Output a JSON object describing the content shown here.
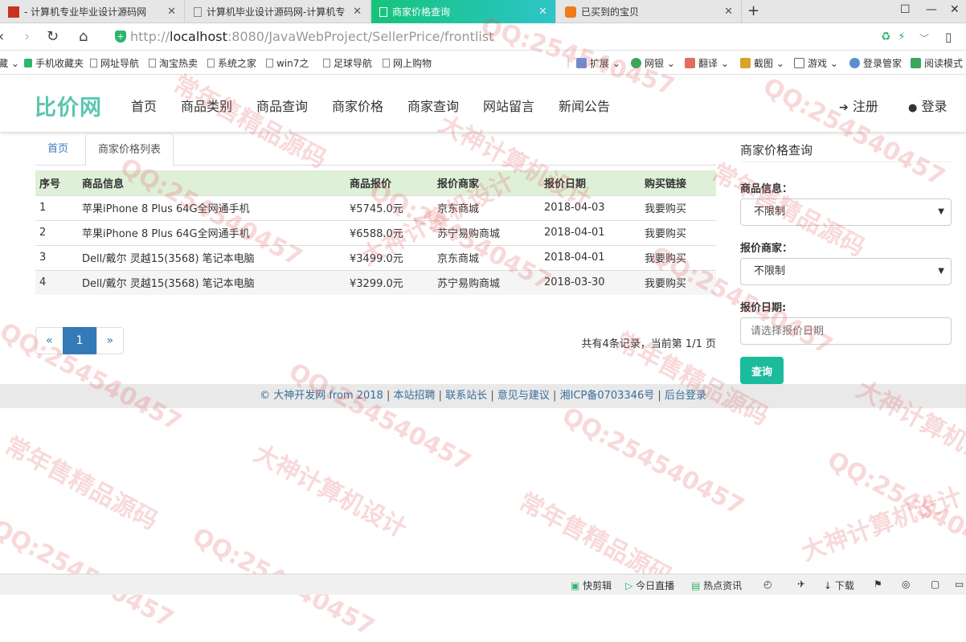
{
  "browser": {
    "tabs": [
      {
        "title": "- 计算机专业毕业设计源码网",
        "active": false
      },
      {
        "title": "计算机毕业设计源码网-计算机专",
        "active": false
      },
      {
        "title": "商家价格查询",
        "active": true
      },
      {
        "title": "已买到的宝贝",
        "active": false
      }
    ],
    "url_prefix": "http://",
    "url_host": "localhost",
    "url_path": ":8080/JavaWebProject/SellerPrice/frontlist",
    "bookmarks": [
      "藏",
      "手机收藏夹",
      "网址导航",
      "淘宝热卖",
      "系统之家",
      "win7之",
      "足球导航",
      "网上购物"
    ],
    "tools": [
      "扩展",
      "网银",
      "翻译",
      "截图",
      "游戏",
      "登录管家",
      "阅读模式"
    ]
  },
  "site": {
    "brand": "比价网",
    "menu": [
      "首页",
      "商品类别",
      "商品查询",
      "商家价格",
      "商家查询",
      "网站留言",
      "新闻公告"
    ],
    "register": "注册",
    "login": "登录"
  },
  "content": {
    "tabs": [
      "首页",
      "商家价格列表"
    ],
    "columns": [
      "序号",
      "商品信息",
      "商品报价",
      "报价商家",
      "报价日期",
      "购买链接"
    ],
    "rows": [
      {
        "no": "1",
        "product": "苹果iPhone 8 Plus 64G全网通手机",
        "price": "¥5745.0元",
        "seller": "京东商城",
        "date": "2018-04-03",
        "link": "我要购买"
      },
      {
        "no": "2",
        "product": "苹果iPhone 8 Plus 64G全网通手机",
        "price": "¥6588.0元",
        "seller": "苏宁易购商城",
        "date": "2018-04-01",
        "link": "我要购买"
      },
      {
        "no": "3",
        "product": "Dell/戴尔 灵越15(3568) 笔记本电脑",
        "price": "¥3499.0元",
        "seller": "京东商城",
        "date": "2018-04-01",
        "link": "我要购买"
      },
      {
        "no": "4",
        "product": "Dell/戴尔 灵越15(3568) 笔记本电脑",
        "price": "¥3299.0元",
        "seller": "苏宁易购商城",
        "date": "2018-03-30",
        "link": "我要购买"
      }
    ],
    "pager": {
      "prev": "«",
      "current": "1",
      "next": "»"
    },
    "page_info": "共有4条记录，当前第 1/1 页"
  },
  "sidebar": {
    "title": "商家价格查询",
    "product_label": "商品信息：",
    "product_value": "不限制",
    "seller_label": "报价商家：",
    "seller_value": "不限制",
    "date_label": "报价日期:",
    "date_placeholder": "请选择报价日期",
    "query_button": "查询"
  },
  "footer": {
    "copyright": "© 大神开发网 from 2018",
    "links": [
      "本站招聘",
      "联系站长",
      "意见与建议",
      "湘ICP备0703346号",
      "后台登录"
    ]
  },
  "watermarks": [
    "QQ:254540457",
    "大神计算机设计",
    "常年售精品源码"
  ],
  "statusbar": [
    "快剪辑",
    "今日直播",
    "热点资讯",
    "下载"
  ]
}
